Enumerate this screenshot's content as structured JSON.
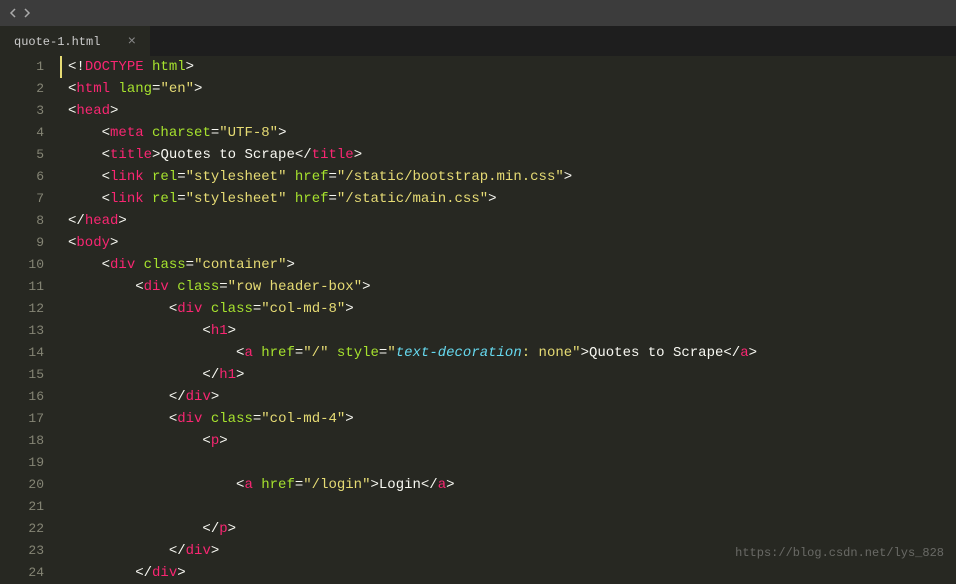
{
  "tab": {
    "filename": "quote-1.html",
    "close": "×"
  },
  "lineNumbers": [
    "1",
    "2",
    "3",
    "4",
    "5",
    "6",
    "7",
    "8",
    "9",
    "10",
    "11",
    "12",
    "13",
    "14",
    "15",
    "16",
    "17",
    "18",
    "19",
    "20",
    "21",
    "22",
    "23",
    "24"
  ],
  "tokens": {
    "lt": "<",
    "gt": ">",
    "lts": "</",
    "lte": "<!",
    "doctype": "DOCTYPE",
    "html_attr": "html",
    "html": "html",
    "lang": "lang",
    "eq": "=",
    "en": "\"en\"",
    "head": "head",
    "meta": "meta",
    "charset": "charset",
    "utf8": "\"UTF-8\"",
    "title": "title",
    "title_text": "Quotes to Scrape",
    "link": "link",
    "rel": "rel",
    "stylesheet": "\"stylesheet\"",
    "href": "href",
    "css1": "\"/static/bootstrap.min.css\"",
    "css2": "\"/static/main.css\"",
    "body": "body",
    "div": "div",
    "class": "class",
    "container": "\"container\"",
    "rowhb": "\"row header-box\"",
    "col8": "\"col-md-8\"",
    "col4": "\"col-md-4\"",
    "h1": "h1",
    "a": "a",
    "p": "p",
    "root_href": "\"/\"",
    "style": "style",
    "td_label": "text-decoration",
    "td_rest": ": none\"",
    "qts": "Quotes to Scrape",
    "login_href": "\"/login\"",
    "login": "Login",
    "indent1": "    ",
    "indent2": "        ",
    "indent3": "            ",
    "indent4": "                ",
    "indent5": "                    ",
    "indent5b": "                ",
    "indent6": "                        ",
    "q": "\""
  },
  "watermark": "https://blog.csdn.net/lys_828"
}
